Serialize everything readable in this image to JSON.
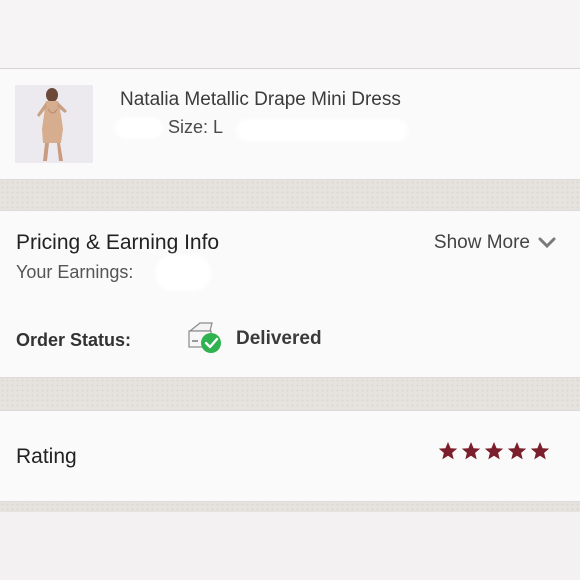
{
  "product": {
    "title": "Natalia Metallic Drape Mini Dress",
    "size": "Size: L",
    "thumbnail_icon": "dress-photo"
  },
  "pricing": {
    "title": "Pricing & Earning Info",
    "show_more": "Show More",
    "earnings_label": "Your Earnings:"
  },
  "order_status": {
    "label": "Order Status:",
    "value": "Delivered",
    "icon": "delivered-box-icon"
  },
  "rating": {
    "label": "Rating",
    "stars": 5,
    "max_stars": 5,
    "star_color": "#7a1f2b"
  },
  "colors": {
    "check_green": "#2fb24f",
    "separator": "#e6e2de"
  }
}
